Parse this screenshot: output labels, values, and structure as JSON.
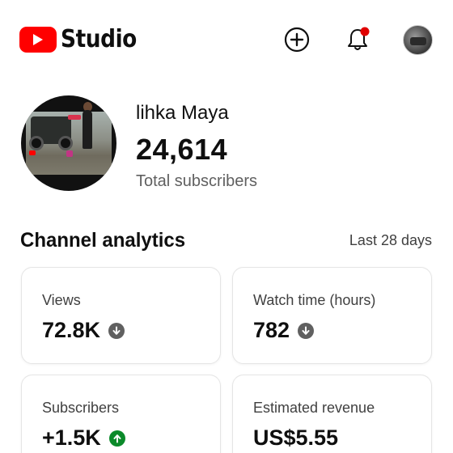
{
  "header": {
    "logo_text": "Studio",
    "create_icon": "plus-circle-icon",
    "notifications_icon": "bell-icon",
    "notification_dot_color": "#e00000",
    "brand_color": "#ff0000"
  },
  "channel": {
    "name": "lihka Maya",
    "subscriber_count": "24,614",
    "subscriber_label": "Total subscribers"
  },
  "analytics": {
    "title": "Channel analytics",
    "period": "Last 28 days",
    "cards": [
      {
        "label": "Views",
        "value": "72.8K",
        "trend": "down"
      },
      {
        "label": "Watch time (hours)",
        "value": "782",
        "trend": "down"
      },
      {
        "label": "Subscribers",
        "value": "+1.5K",
        "trend": "up"
      },
      {
        "label": "Estimated revenue",
        "value": "US$5.55",
        "trend": "none"
      }
    ],
    "trend_colors": {
      "down": "#606060",
      "up": "#0b8a2a"
    }
  }
}
